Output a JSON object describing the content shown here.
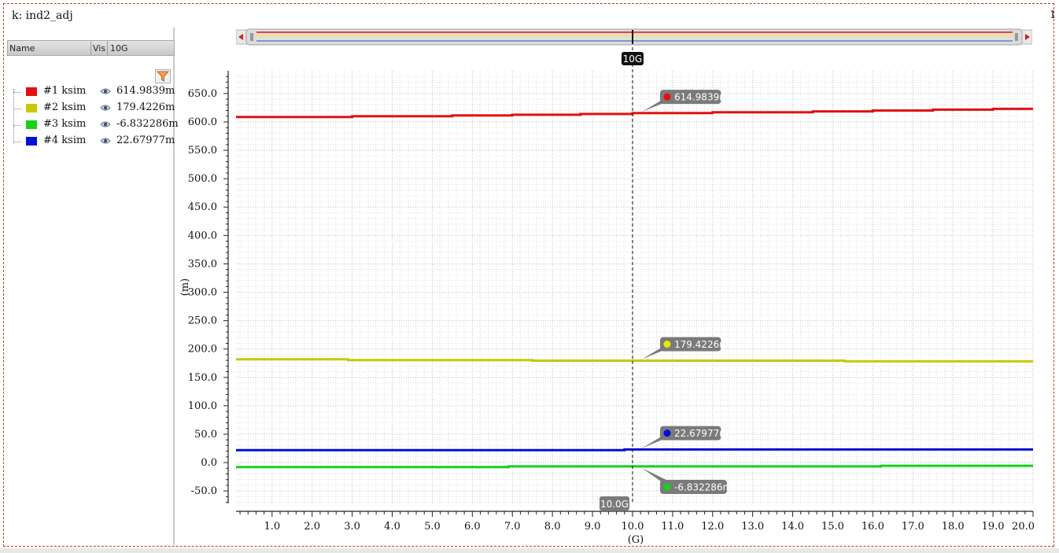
{
  "window": {
    "title": "k: ind2_adj",
    "corner_text": "1"
  },
  "signal_panel": {
    "columns": [
      "Name",
      "Vis",
      "10G"
    ],
    "filter_icon": "funnel-icon",
    "signals": [
      {
        "name": "#1 ksim",
        "value": "614.9839m",
        "color": "#e31010"
      },
      {
        "name": "#2 ksim",
        "value": "179.4226m",
        "color": "#c8c800"
      },
      {
        "name": "#3 ksim",
        "value": "-6.832286m",
        "color": "#18d018"
      },
      {
        "name": "#4 ksim",
        "value": "22.67977m",
        "color": "#0010d8"
      }
    ],
    "visibility_icon": "eye-icon"
  },
  "cursor": {
    "label": "10G",
    "x_label": "10.0G",
    "x": 10.0
  },
  "chart_data": {
    "type": "line",
    "title": "",
    "xlabel": "(G)",
    "ylabel": "(m)",
    "xlim": [
      0.1,
      20.0
    ],
    "ylim": [
      -72,
      690
    ],
    "x_ticks": [
      1.0,
      2.0,
      3.0,
      4.0,
      5.0,
      6.0,
      7.0,
      8.0,
      9.0,
      10.0,
      11.0,
      12.0,
      13.0,
      14.0,
      15.0,
      16.0,
      17.0,
      18.0,
      19.0,
      20.0
    ],
    "x_tick_labels": [
      "1.0",
      "2.0",
      "3.0",
      "4.0",
      "5.0",
      "6.0",
      "7.0",
      "8.0",
      "9.0",
      "10.0",
      "11.0",
      "12.0",
      "13.0",
      "14.0",
      "15.0",
      "16.0",
      "17.0",
      "18.0",
      "19.0",
      "20.0"
    ],
    "y_ticks": [
      -50,
      0,
      50,
      100,
      150,
      200,
      250,
      300,
      350,
      400,
      450,
      500,
      550,
      600,
      650
    ],
    "y_tick_labels": [
      "-50.0",
      "0.0",
      "50.0",
      "100.0",
      "150.0",
      "200.0",
      "250.0",
      "300.0",
      "350.0",
      "400.0",
      "450.0",
      "500.0",
      "550.0",
      "600.0",
      "650.0"
    ],
    "grid": true,
    "series": [
      {
        "name": "#1 ksim",
        "color": "#e31010",
        "x": [
          0.1,
          3.0,
          3.0,
          5.5,
          5.5,
          7.0,
          7.0,
          8.7,
          8.7,
          10.0,
          10.0,
          12.0,
          12.0,
          14.5,
          14.5,
          16.0,
          16.0,
          17.5,
          17.5,
          19.0,
          19.0,
          20.0
        ],
        "y": [
          608.5,
          608.5,
          610,
          610,
          611.5,
          611.5,
          612.5,
          612.5,
          614,
          614,
          615.5,
          615.5,
          617,
          617,
          618.5,
          618.5,
          620,
          620,
          621.5,
          621.5,
          623,
          623
        ]
      },
      {
        "name": "#2 ksim",
        "color": "#c8c800",
        "x": [
          0.1,
          2.9,
          2.9,
          7.5,
          7.5,
          15.3,
          15.3,
          20.0
        ],
        "y": [
          182,
          182,
          180.5,
          180.5,
          179.4,
          179.4,
          178.2,
          178.2
        ]
      },
      {
        "name": "#3 ksim",
        "color": "#18d018",
        "x": [
          0.1,
          6.9,
          6.9,
          16.2,
          16.2,
          20.0
        ],
        "y": [
          -8,
          -8,
          -6.8,
          -6.8,
          -5.6,
          -5.6
        ]
      },
      {
        "name": "#4 ksim",
        "color": "#0010d8",
        "x": [
          0.1,
          9.8,
          9.8,
          20.0
        ],
        "y": [
          22.0,
          22.0,
          23.0,
          23.0
        ]
      }
    ],
    "markers": [
      {
        "series": "#1 ksim",
        "x": 10.0,
        "y": 614.9839,
        "label": "614.9839m",
        "color": "#e31010",
        "side": "up"
      },
      {
        "series": "#2 ksim",
        "x": 10.0,
        "y": 179.4226,
        "label": "179.4226m",
        "color": "#e8e800",
        "side": "up"
      },
      {
        "series": "#4 ksim",
        "x": 10.0,
        "y": 22.67977,
        "label": "22.67977m",
        "color": "#0010d8",
        "side": "up"
      },
      {
        "series": "#3 ksim",
        "x": 10.0,
        "y": -6.832286,
        "label": "-6.832286m",
        "color": "#18d018",
        "side": "down"
      }
    ]
  }
}
